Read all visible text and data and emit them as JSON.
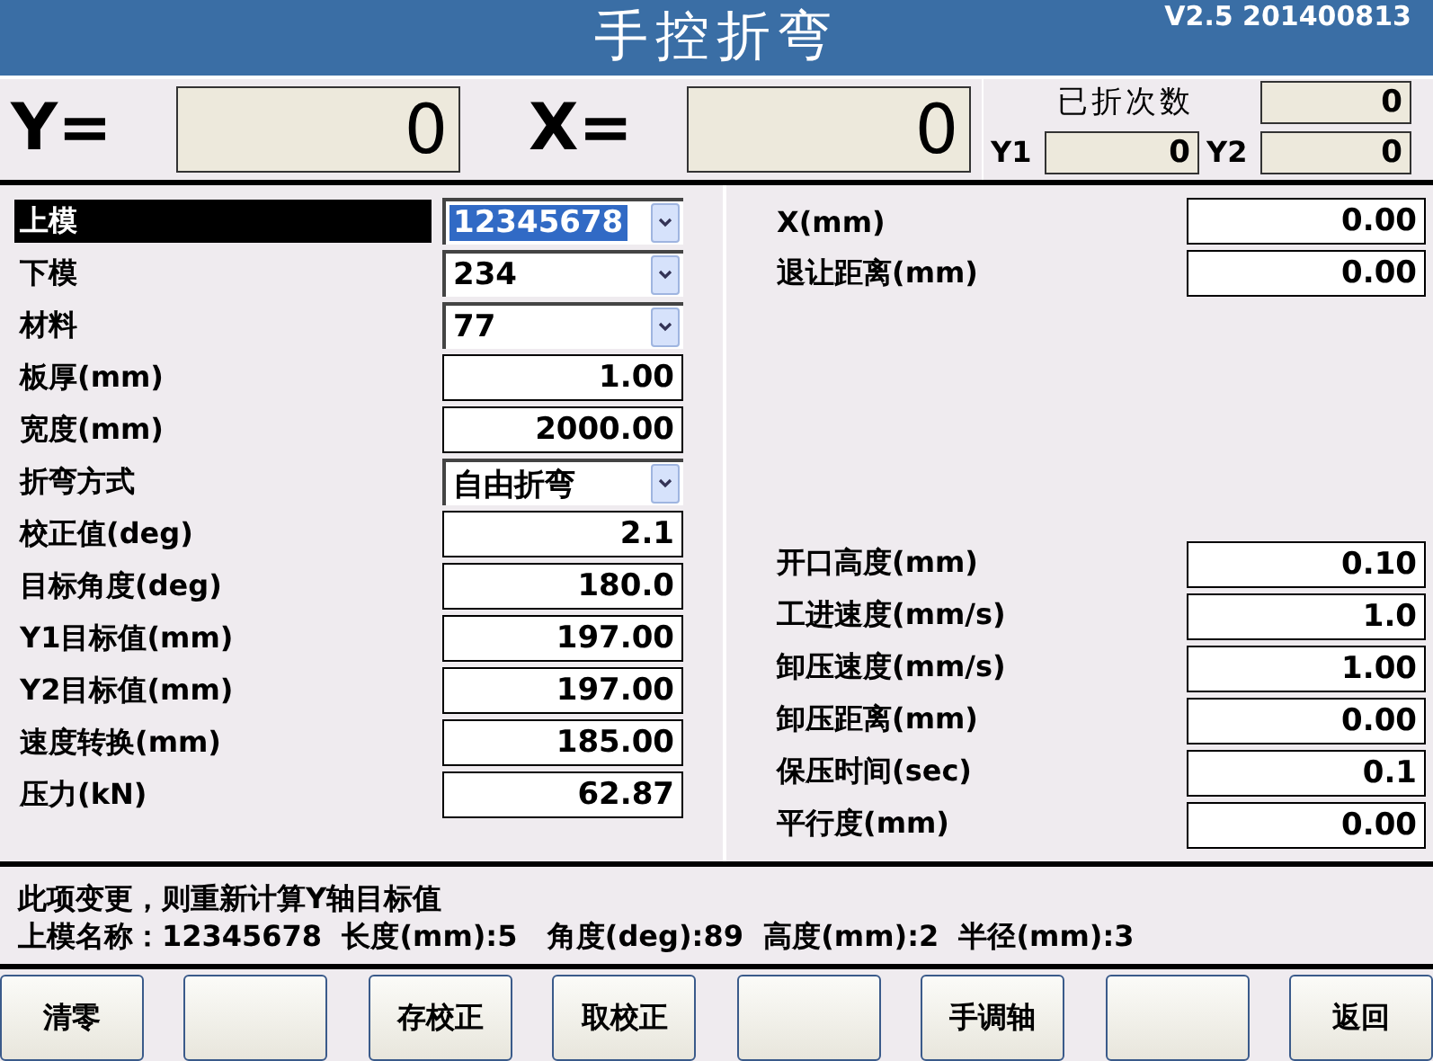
{
  "title": "手控折弯",
  "version": "V2.5 201400813",
  "position": {
    "y_label": "Y=",
    "y_value": "0",
    "x_label": "X=",
    "x_value": "0"
  },
  "counter": {
    "label": "已折次数",
    "value": "0",
    "y1_label": "Y1",
    "y1_value": "0",
    "y2_label": "Y2",
    "y2_value": "0"
  },
  "left_params": [
    {
      "label": "上模",
      "value": "12345678",
      "kind": "select",
      "selected": true
    },
    {
      "label": "下模",
      "value": "234",
      "kind": "select",
      "selected": false
    },
    {
      "label": "材料",
      "value": "77",
      "kind": "select",
      "selected": false
    },
    {
      "label": "板厚(mm)",
      "value": "1.00",
      "kind": "input",
      "selected": false
    },
    {
      "label": "宽度(mm)",
      "value": "2000.00",
      "kind": "input",
      "selected": false
    },
    {
      "label": "折弯方式",
      "value": "自由折弯",
      "kind": "select",
      "selected": false
    },
    {
      "label": "校正值(deg)",
      "value": "2.1",
      "kind": "input",
      "selected": false
    },
    {
      "label": "目标角度(deg)",
      "value": "180.0",
      "kind": "input",
      "selected": false
    },
    {
      "label": "Y1目标值(mm)",
      "value": "197.00",
      "kind": "input",
      "selected": false
    },
    {
      "label": "Y2目标值(mm)",
      "value": "197.00",
      "kind": "input",
      "selected": false
    },
    {
      "label": "速度转换(mm)",
      "value": "185.00",
      "kind": "input",
      "selected": false
    },
    {
      "label": "压力(kN)",
      "value": "62.87",
      "kind": "input",
      "selected": false
    }
  ],
  "right_params_top": [
    {
      "label": "X(mm)",
      "value": "0.00"
    },
    {
      "label": "退让距离(mm)",
      "value": "0.00"
    }
  ],
  "right_params_bottom": [
    {
      "label": "开口高度(mm)",
      "value": "0.10"
    },
    {
      "label": "工进速度(mm/s)",
      "value": "1.0"
    },
    {
      "label": "卸压速度(mm/s)",
      "value": "1.00"
    },
    {
      "label": "卸压距离(mm)",
      "value": "0.00"
    },
    {
      "label": "保压时间(sec)",
      "value": "0.1"
    },
    {
      "label": "平行度(mm)",
      "value": "0.00"
    }
  ],
  "message": "此项变更，则重新计算Y轴目标值",
  "die_info": "上模名称：12345678  长度(mm):5   角度(deg):89  高度(mm):2  半径(mm):3",
  "buttons": [
    {
      "kind": "text",
      "label": "清零"
    },
    {
      "kind": "blank"
    },
    {
      "kind": "text",
      "label": "存校正"
    },
    {
      "kind": "text",
      "label": "取校正"
    },
    {
      "kind": "blank"
    },
    {
      "kind": "text",
      "label": "手调轴"
    },
    {
      "kind": "blank"
    },
    {
      "kind": "text",
      "label": "返回"
    }
  ]
}
